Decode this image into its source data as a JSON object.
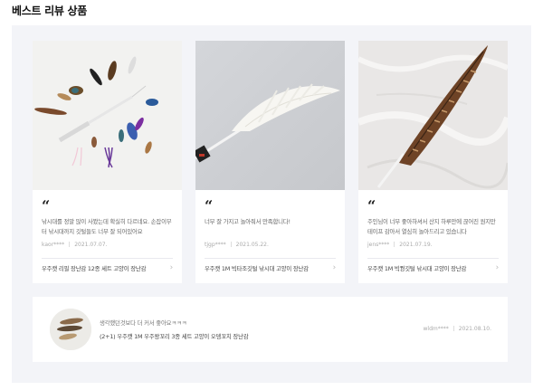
{
  "section": {
    "title": "베스트 리뷰 상품"
  },
  "quote_mark": "“",
  "chevron": "›",
  "cards": [
    {
      "image": "cat-toy-feather-set-photo",
      "review": "낚시대를 정말 많이 사봤는데 확실히 다르네요. 손잡이부터 낚시대까지 깃털들도 너무 잘 되어있어요",
      "author": "kaor****",
      "date": "2021.07.07.",
      "product": "우주캣 리필 장난감 12종 세트 고양이 장난감"
    },
    {
      "image": "white-feather-wand-photo",
      "review": "너무 잘 가지고 놀아줘서 만족합니다!",
      "author": "tjgp****",
      "date": "2021.05.22.",
      "product": "우주캣 1M 빅타조깃털 낚시대 고양이 장난감"
    },
    {
      "image": "pheasant-feather-wand-photo",
      "review": "주인님이 너무 좋아하셔서 산지 하루만에 끊어진 원지만 테이프 감아서 열심히 놀아드리고 있습니다",
      "author": "jens****",
      "date": "2021.07.19.",
      "product": "우주캣 1M 빅꿩깃털 낚시대 고양이 장난감"
    }
  ],
  "wide_review": {
    "image": "feather-toy-round-thumbnail",
    "review": "생각했던것보다 더 커서 좋아요ㅋㅋㅋ",
    "product": "(2+1) 우주캣 1M 우주왕꼬리 3종 세트 고양이 오뎅꼬치 장난감",
    "author": "wldm****",
    "date": "2021.08.10."
  }
}
